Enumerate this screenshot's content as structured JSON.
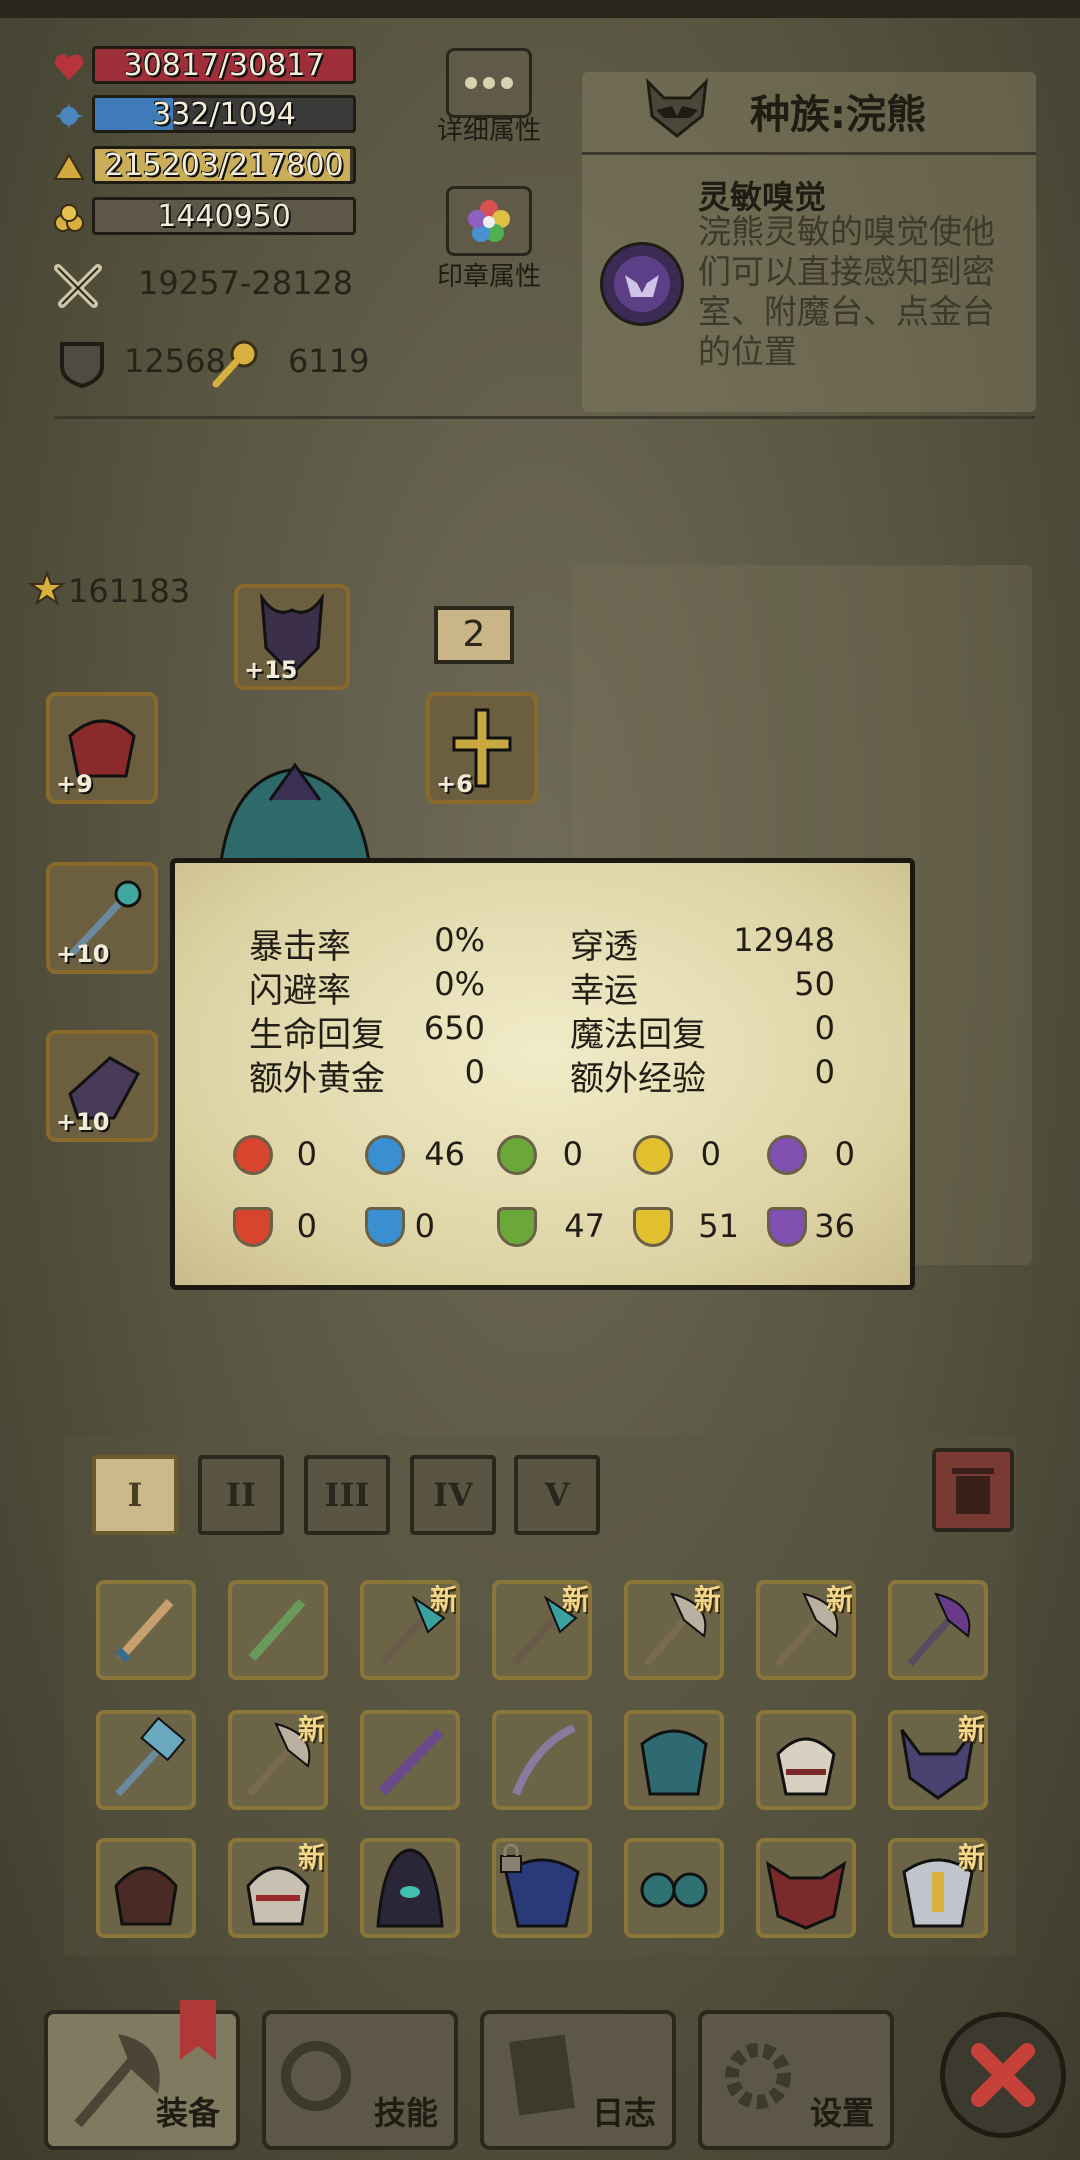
{
  "stats": {
    "hp": "30817/30817",
    "mp": "332/1094",
    "exp": "215203/217800",
    "gold": "1440950",
    "attack": "19257-28128",
    "defense": "12568",
    "key_count": "6119"
  },
  "progress": {
    "hp": 1.0,
    "mp": 0.303,
    "exp": 0.988
  },
  "buttons": {
    "detail_label": "详细属性",
    "seal_label": "印章属性"
  },
  "race": {
    "title": "种族:浣熊",
    "skill_name": "灵敏嗅觉",
    "skill_desc": "浣熊灵敏的嗅觉使他们可以直接感知到密室、附魔台、点金台的位置"
  },
  "equipment": {
    "star_score": "161183",
    "count_badge": "2",
    "levels": {
      "helmet": "+15",
      "shoulder": "+9",
      "amulet": "+6",
      "staff": "+10",
      "glove": "+10"
    }
  },
  "popup": {
    "rows": [
      {
        "l_label": "暴击率",
        "l_val": "0%",
        "r_label": "穿透",
        "r_val": "12948"
      },
      {
        "l_label": "闪避率",
        "l_val": "0%",
        "r_label": "幸运",
        "r_val": "50"
      },
      {
        "l_label": "生命回复",
        "l_val": "650",
        "r_label": "魔法回复",
        "r_val": "0"
      },
      {
        "l_label": "额外黄金",
        "l_val": "0",
        "r_label": "额外经验",
        "r_val": "0"
      }
    ],
    "attack_elements": [
      "0",
      "46",
      "0",
      "0",
      "0"
    ],
    "resist_elements": [
      "0",
      "0",
      "47",
      "51",
      "36"
    ]
  },
  "inventory": {
    "tabs": [
      "I",
      "II",
      "III",
      "IV",
      "V"
    ],
    "new_label": "新"
  },
  "bottom_nav": {
    "equip": "装备",
    "skill": "技能",
    "log": "日志",
    "settings": "设置"
  },
  "colors": {
    "hp": "#a8303a",
    "mp": "#3d7ab5",
    "exp": "#cdb25a",
    "fire": "#d8452e",
    "water": "#3a8fd0",
    "leaf": "#6aa83a",
    "light": "#e2c030",
    "dark": "#8050b0"
  }
}
